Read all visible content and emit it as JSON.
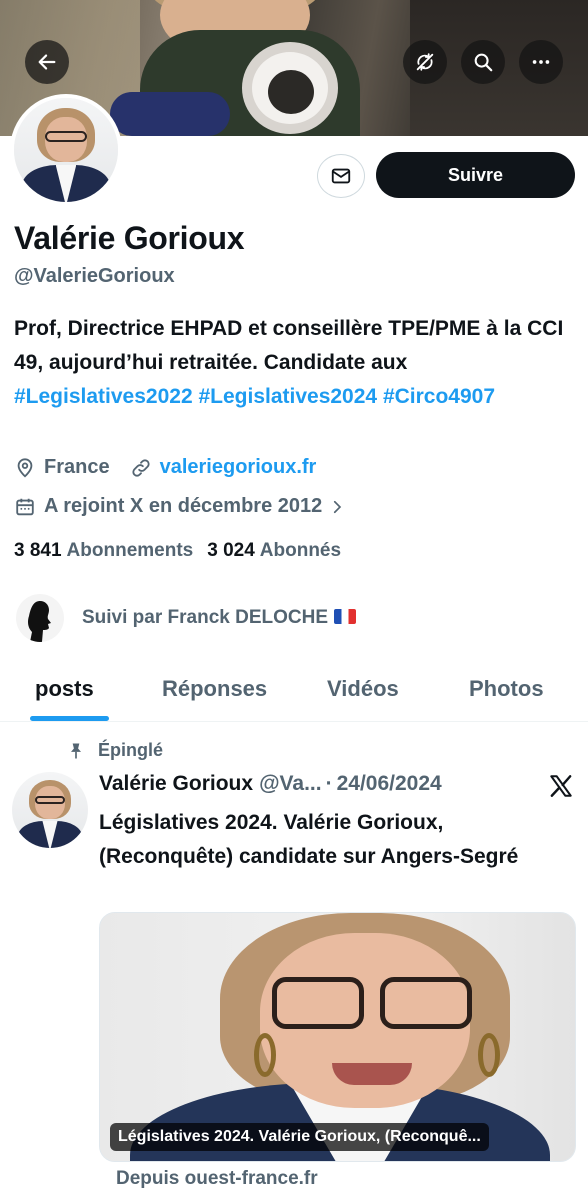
{
  "header": {
    "back_icon": "arrow-left-icon",
    "actions": [
      "repost-off-icon",
      "search-icon",
      "more-icon"
    ]
  },
  "profile": {
    "name": "Valérie Gorioux",
    "handle": "@ValerieGorioux",
    "follow_label": "Suivre",
    "bio_text": "Prof, Directrice EHPAD et conseillère TPE/PME à la CCI 49, aujourd’hui retraitée. Candidate aux ",
    "bio_tags": [
      "#Legislatives2022",
      "#Legislatives2024",
      "#Circo4907"
    ],
    "location": "France",
    "website": "valeriegorioux.fr",
    "joined": "A rejoint X en décembre 2012",
    "following_count": "3 841",
    "following_label": "Abonnements",
    "followers_count": "3 024",
    "followers_label": "Abonnés",
    "followed_by": "Suivi par Franck DELOCHE"
  },
  "tabs": [
    {
      "label": "posts",
      "active": true
    },
    {
      "label": "Réponses",
      "active": false
    },
    {
      "label": "Vidéos",
      "active": false
    },
    {
      "label": "Photos",
      "active": false
    }
  ],
  "pinned_post": {
    "pinned_label": "Épinglé",
    "author": "Valérie Gorioux",
    "handle_truncated": "@Va...",
    "separator": "·",
    "date": "24/06/2024",
    "text": "Législatives 2024. Valérie Gorioux, (Reconquête) candidate sur Angers-Segré",
    "card_caption": "Législatives 2024. Valérie Gorioux, (Reconquê...",
    "card_source": "Depuis ouest-france.fr"
  },
  "colors": {
    "accent": "#1d9bf0",
    "text": "#0f1419",
    "muted": "#536471",
    "button": "#0f1419"
  }
}
